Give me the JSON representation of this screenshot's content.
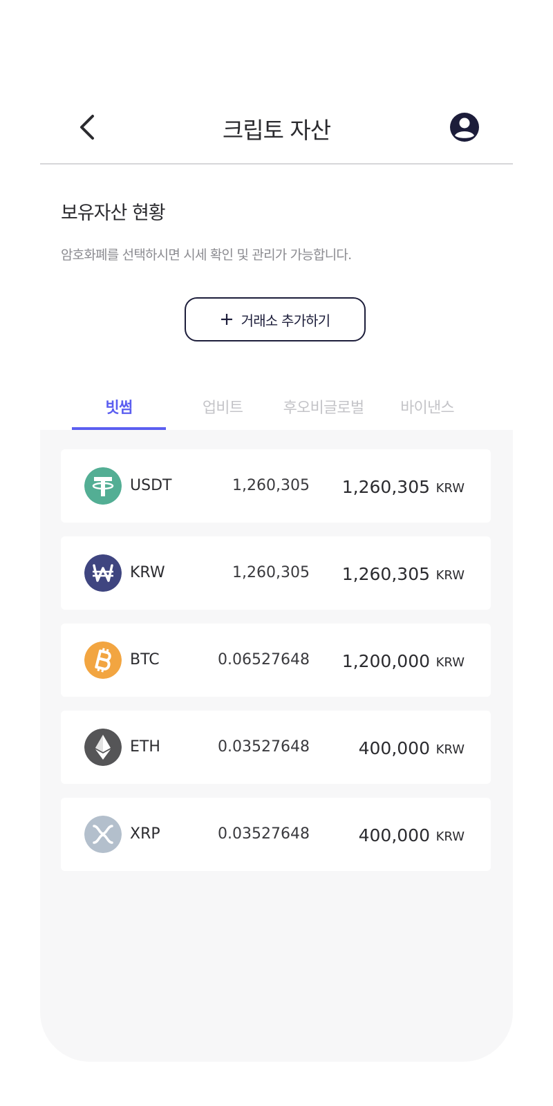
{
  "header": {
    "title": "크립토 자산",
    "back_icon": "chevron-left-icon",
    "profile_icon": "user-circle-icon"
  },
  "section": {
    "title": "보유자산 현황",
    "description": "암호화폐를 선택하시면 시세 확인 및 관리가 가능합니다.",
    "add_button_label": "거래소 추가하기",
    "add_button_icon": "plus-icon"
  },
  "tabs": [
    {
      "label": "빗썸",
      "active": true
    },
    {
      "label": "업비트",
      "active": false
    },
    {
      "label": "후오비글로벌",
      "active": false
    },
    {
      "label": "바이낸스",
      "active": false
    }
  ],
  "assets": [
    {
      "symbol": "USDT",
      "amount": "1,260,305",
      "value": "1,260,305",
      "unit": "KRW",
      "icon": "tether-icon",
      "color": "#53ae94"
    },
    {
      "symbol": "KRW",
      "amount": "1,260,305",
      "value": "1,260,305",
      "unit": "KRW",
      "icon": "won-icon",
      "color": "#3f4580"
    },
    {
      "symbol": "BTC",
      "amount": "0.06527648",
      "value": "1,200,000",
      "unit": "KRW",
      "icon": "bitcoin-icon",
      "color": "#f2a541"
    },
    {
      "symbol": "ETH",
      "amount": "0.03527648",
      "value": "400,000",
      "unit": "KRW",
      "icon": "ethereum-icon",
      "color": "#555557"
    },
    {
      "symbol": "XRP",
      "amount": "0.03527648",
      "value": "400,000",
      "unit": "KRW",
      "icon": "ripple-icon",
      "color": "#b3bfcc"
    }
  ],
  "colors": {
    "accent": "#5b5ef0",
    "dark": "#1c1d3a",
    "panel_bg": "#f7f7f8"
  }
}
